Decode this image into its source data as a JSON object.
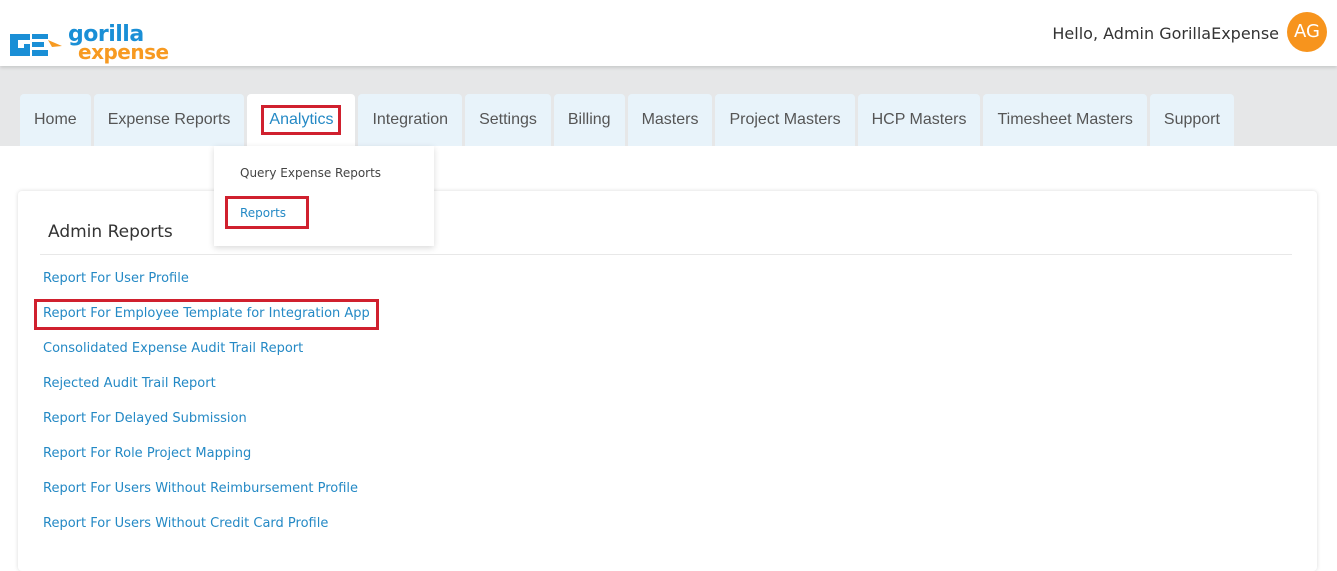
{
  "header": {
    "logo": {
      "word1": "gorilla",
      "word2": "expense"
    },
    "greeting": "Hello, Admin GorillaExpense",
    "avatar_initials": "AG"
  },
  "nav": {
    "tabs": [
      {
        "label": "Home"
      },
      {
        "label": "Expense Reports"
      },
      {
        "label": "Analytics",
        "active": true
      },
      {
        "label": "Integration"
      },
      {
        "label": "Settings"
      },
      {
        "label": "Billing"
      },
      {
        "label": "Masters"
      },
      {
        "label": "Project Masters"
      },
      {
        "label": "HCP Masters"
      },
      {
        "label": "Timesheet Masters"
      },
      {
        "label": "Support"
      }
    ]
  },
  "dropdown": {
    "items": [
      {
        "label": "Query Expense Reports"
      },
      {
        "label": "Reports",
        "highlighted": true
      }
    ]
  },
  "main": {
    "title": "Admin Reports",
    "reports": [
      "Report For User Profile",
      "Report For Employee Template for Integration App",
      "Consolidated Expense Audit Trail Report",
      "Rejected Audit Trail Report",
      "Report For Delayed Submission",
      "Report For Role Project Mapping",
      "Report For Users Without Reimbursement Profile",
      "Report For Users Without Credit Card Profile"
    ]
  },
  "colors": {
    "accent_blue": "#2489c5",
    "brand_orange": "#f7941d",
    "highlight_red": "#d0202e",
    "tab_bg": "#e8f3fa",
    "nav_band": "#e6e7e8"
  },
  "icons": {
    "logo": "gorilla-expense-logo-icon"
  }
}
